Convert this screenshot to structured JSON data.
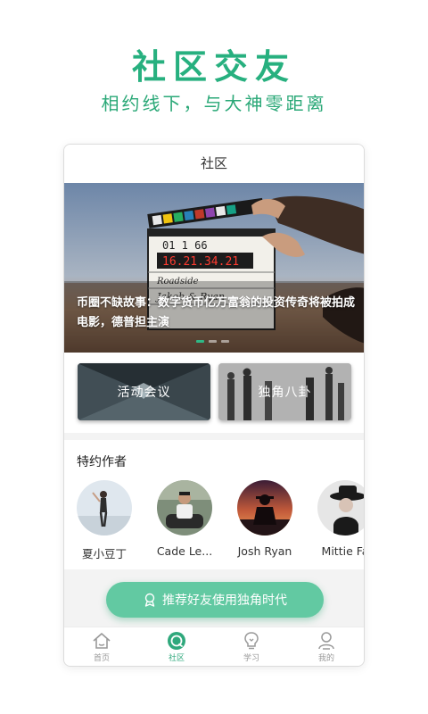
{
  "hero": {
    "title": "社区交友",
    "subtitle": "相约线下，与大神零距离"
  },
  "app": {
    "header_title": "社区",
    "banner": {
      "caption": "币圈不缺故事：数字货币亿万富翁的投资传奇将被拍成电影，德普担主演",
      "clapper_number": "16.21.34.21",
      "clapper_line1": "Roadside",
      "clapper_line2": "Jakob & Ryan",
      "active_dot": 0
    },
    "tiles": [
      {
        "label": "活动会议"
      },
      {
        "label": "独角八卦"
      }
    ],
    "authors": {
      "title": "特约作者",
      "items": [
        {
          "name": "夏小豆丁"
        },
        {
          "name": "Cade Le..."
        },
        {
          "name": "Josh Ryan"
        },
        {
          "name": "Mittie Fa"
        }
      ]
    },
    "cta": {
      "label": "推荐好友使用独角时代"
    },
    "tabbar": [
      {
        "label": "首页",
        "icon": "home-icon"
      },
      {
        "label": "社区",
        "icon": "community-icon"
      },
      {
        "label": "学习",
        "icon": "lightbulb-icon"
      },
      {
        "label": "我的",
        "icon": "person-icon"
      }
    ]
  },
  "colors": {
    "accent": "#27b07f",
    "cta": "#62c9a2"
  }
}
